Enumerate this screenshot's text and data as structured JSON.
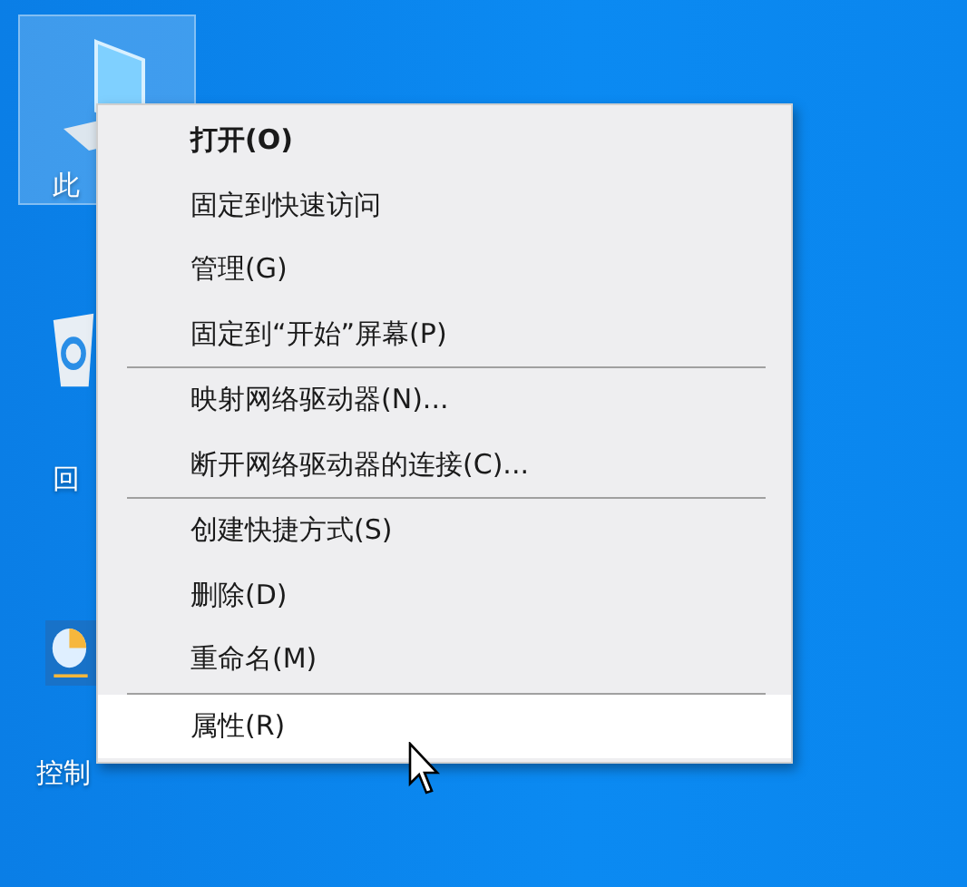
{
  "desktop_icons": [
    {
      "kind": "computer",
      "label": "此",
      "selected": true
    },
    {
      "kind": "recycle",
      "label": "回",
      "selected": false
    },
    {
      "kind": "control",
      "label": "控制",
      "selected": false
    }
  ],
  "context_menu": {
    "items": [
      {
        "kind": "item",
        "label": "打开(O)",
        "default": true,
        "selected": false
      },
      {
        "kind": "item",
        "label": "固定到快速访问",
        "default": false,
        "selected": false
      },
      {
        "kind": "item",
        "label": "管理(G)",
        "default": false,
        "selected": false
      },
      {
        "kind": "item",
        "label": "固定到“开始”屏幕(P)",
        "default": false,
        "selected": false
      },
      {
        "kind": "separator"
      },
      {
        "kind": "item",
        "label": "映射网络驱动器(N)...",
        "default": false,
        "selected": false
      },
      {
        "kind": "item",
        "label": "断开网络驱动器的连接(C)...",
        "default": false,
        "selected": false
      },
      {
        "kind": "separator"
      },
      {
        "kind": "item",
        "label": "创建快捷方式(S)",
        "default": false,
        "selected": false
      },
      {
        "kind": "item",
        "label": "删除(D)",
        "default": false,
        "selected": false
      },
      {
        "kind": "item",
        "label": "重命名(M)",
        "default": false,
        "selected": false
      },
      {
        "kind": "separator"
      },
      {
        "kind": "item",
        "label": "属性(R)",
        "default": false,
        "selected": true
      }
    ]
  }
}
